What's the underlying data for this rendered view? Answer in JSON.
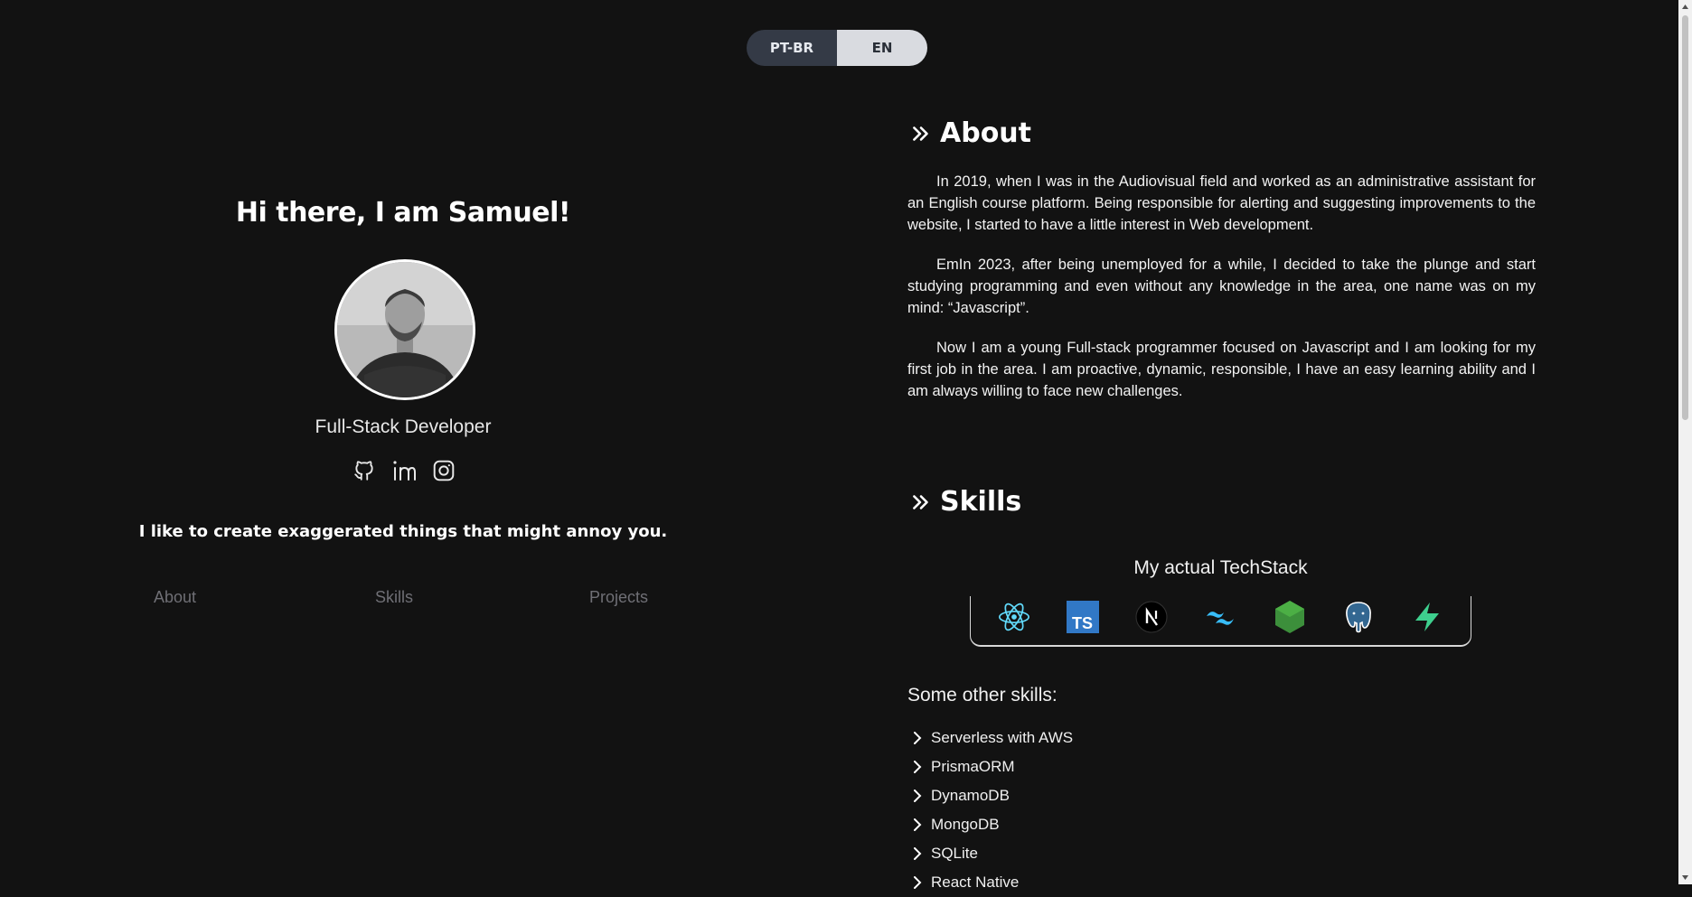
{
  "language_toggle": {
    "pt_label": "PT-BR",
    "en_label": "EN",
    "selected": "EN"
  },
  "profile": {
    "greeting": "Hi there, I am Samuel!",
    "role": "Full-Stack Developer",
    "tagline": "I like to create exaggerated things that might annoy you.",
    "socials": [
      "github-icon",
      "linkedin-icon",
      "instagram-icon"
    ]
  },
  "nav": {
    "about": "About",
    "skills": "Skills",
    "projects": "Projects"
  },
  "about": {
    "title": "About",
    "paragraphs": [
      "In 2019, when I was in the Audiovisual field and worked as an administrative assistant for an English course platform. Being responsible for alerting and suggesting improvements to the website, I started to have a little interest in Web development.",
      "EmIn 2023, after being unemployed for a while, I decided to take the plunge and start studying programming and even without any knowledge in the area, one name was on my mind: “Javascript”.",
      "Now I am a young Full-stack programmer focused on Javascript and I am looking for my first job in the area. I am proactive, dynamic, responsible, I have an easy learning ability and I am always willing to face new challenges."
    ]
  },
  "skills": {
    "title": "Skills",
    "techstack_title": "My actual TechStack",
    "techstack_icons": [
      "react-icon",
      "typescript-icon",
      "nextjs-icon",
      "tailwind-icon",
      "nodejs-icon",
      "postgresql-icon",
      "supabase-icon"
    ],
    "other_title": "Some other skills:",
    "other": [
      "Serverless with AWS",
      "PrismaORM",
      "DynamoDB",
      "MongoDB",
      "SQLite",
      "React Native"
    ]
  },
  "colors": {
    "background": "#121212",
    "toggle_dark": "#343a46",
    "toggle_light": "#d9dbe0",
    "nav_link": "#6f6f75"
  }
}
